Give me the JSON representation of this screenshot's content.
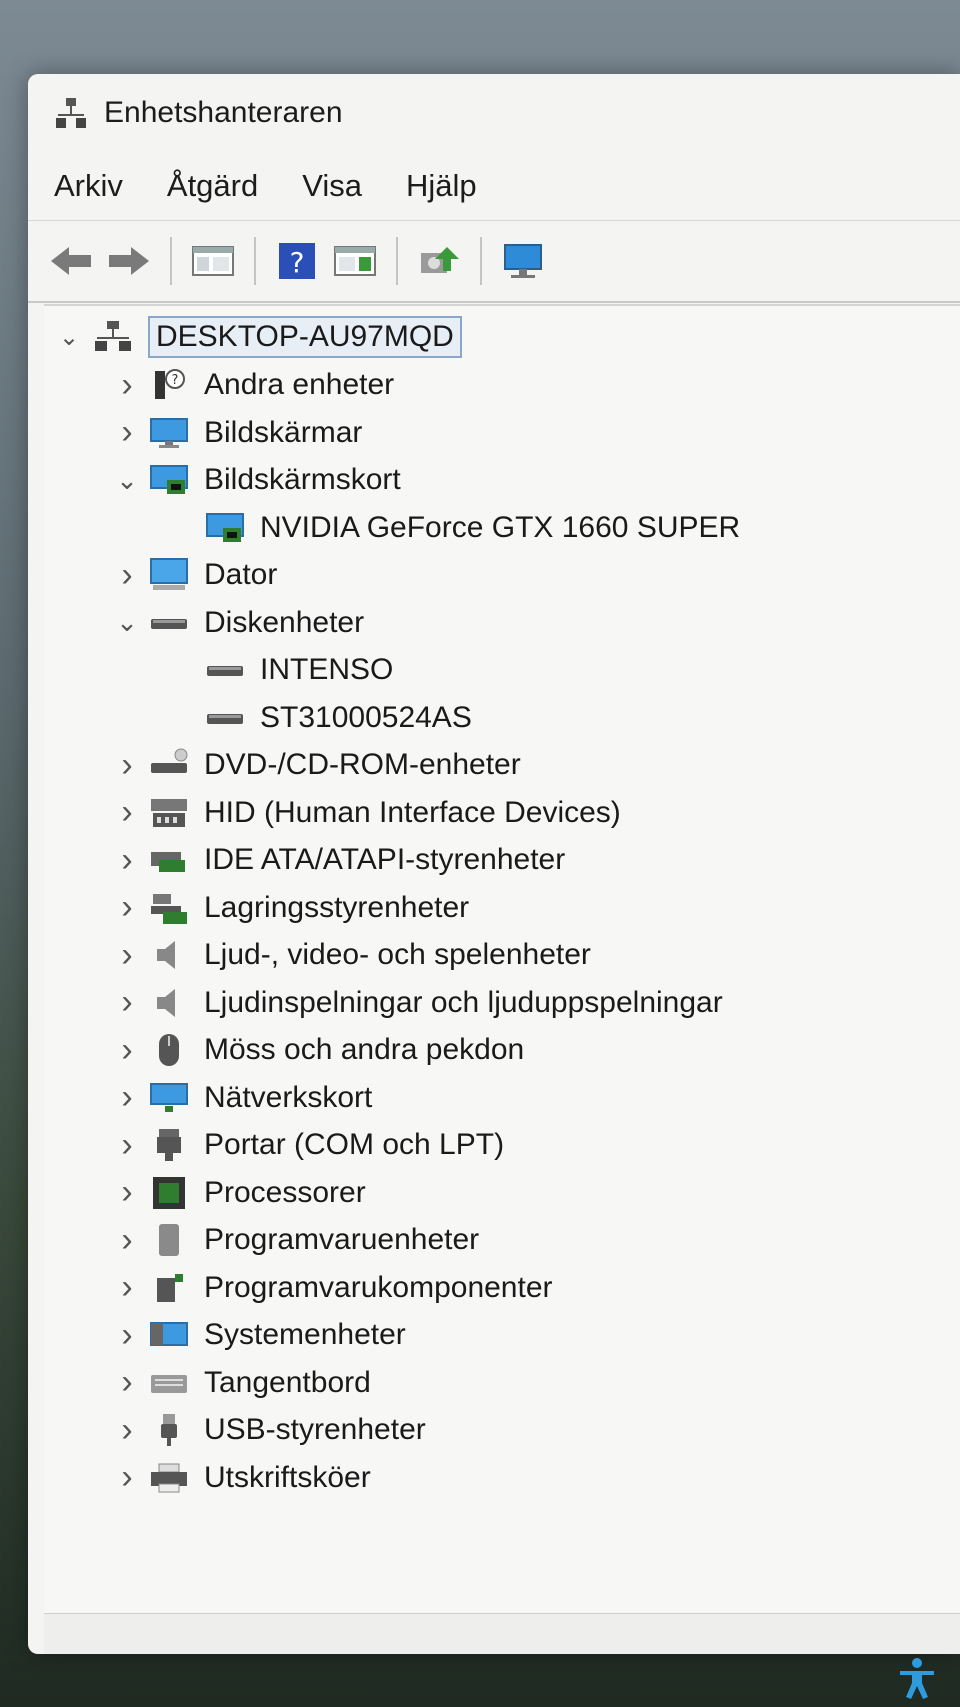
{
  "window": {
    "title": "Enhetshanteraren"
  },
  "menu": [
    "Arkiv",
    "Åtgärd",
    "Visa",
    "Hjälp"
  ],
  "toolbar": [
    {
      "icon": "back-arrow-icon"
    },
    {
      "icon": "forward-arrow-icon"
    },
    {
      "icon": "show-hide-console-tree-icon"
    },
    {
      "icon": "help-icon"
    },
    {
      "icon": "properties-icon"
    },
    {
      "icon": "update-driver-icon"
    },
    {
      "icon": "monitor-icon"
    }
  ],
  "tree": {
    "root": "DESKTOP-AU97MQD",
    "items": [
      {
        "label": "Andra enheter",
        "icon": "unknown-device-icon",
        "expanded": false
      },
      {
        "label": "Bildskärmar",
        "icon": "monitor-icon",
        "expanded": false
      },
      {
        "label": "Bildskärmskort",
        "icon": "display-adapter-icon",
        "expanded": true,
        "children": [
          {
            "label": "NVIDIA GeForce GTX 1660 SUPER",
            "icon": "display-adapter-icon"
          }
        ]
      },
      {
        "label": "Dator",
        "icon": "computer-icon",
        "expanded": false
      },
      {
        "label": "Diskenheter",
        "icon": "disk-drive-icon",
        "expanded": true,
        "children": [
          {
            "label": "INTENSO",
            "icon": "disk-drive-icon"
          },
          {
            "label": "ST31000524AS",
            "icon": "disk-drive-icon"
          }
        ]
      },
      {
        "label": "DVD-/CD-ROM-enheter",
        "icon": "dvd-drive-icon",
        "expanded": false
      },
      {
        "label": "HID (Human Interface Devices)",
        "icon": "hid-icon",
        "expanded": false
      },
      {
        "label": "IDE ATA/ATAPI-styrenheter",
        "icon": "ide-controller-icon",
        "expanded": false
      },
      {
        "label": "Lagringsstyrenheter",
        "icon": "storage-controller-icon",
        "expanded": false
      },
      {
        "label": "Ljud-, video- och spelenheter",
        "icon": "speaker-icon",
        "expanded": false
      },
      {
        "label": "Ljudinspelningar och ljuduppspelningar",
        "icon": "speaker-icon",
        "expanded": false
      },
      {
        "label": "Möss och andra pekdon",
        "icon": "mouse-icon",
        "expanded": false
      },
      {
        "label": "Nätverkskort",
        "icon": "network-adapter-icon",
        "expanded": false
      },
      {
        "label": "Portar (COM och LPT)",
        "icon": "port-icon",
        "expanded": false
      },
      {
        "label": "Processorer",
        "icon": "processor-icon",
        "expanded": false
      },
      {
        "label": "Programvaruenheter",
        "icon": "software-device-icon",
        "expanded": false
      },
      {
        "label": "Programvarukomponenter",
        "icon": "software-component-icon",
        "expanded": false
      },
      {
        "label": "Systemenheter",
        "icon": "system-devices-icon",
        "expanded": false
      },
      {
        "label": "Tangentbord",
        "icon": "keyboard-icon",
        "expanded": false
      },
      {
        "label": "USB-styrenheter",
        "icon": "usb-icon",
        "expanded": false
      },
      {
        "label": "Utskriftsköer",
        "icon": "printer-icon",
        "expanded": false
      }
    ]
  },
  "colors": {
    "window_bg": "#f4f4f2",
    "tree_bg": "#f7f7f6",
    "selection_border": "#8aa6c8",
    "icon_blue": "#2e8bd8",
    "icon_green": "#3a9a3a"
  }
}
